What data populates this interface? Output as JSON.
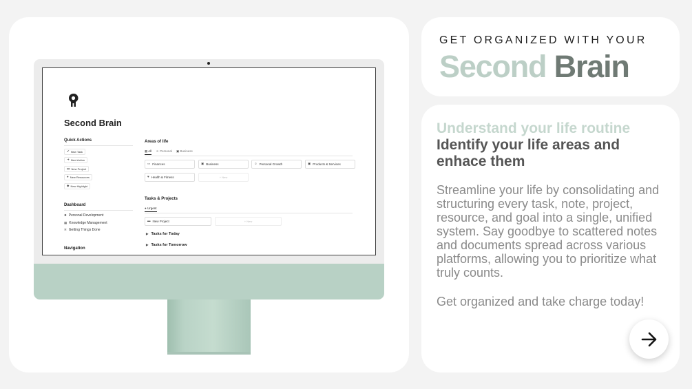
{
  "hero": {
    "eyebrow": "GET ORGANIZED WITH YOUR",
    "title_part1": "Second",
    "title_part2": "Brain"
  },
  "copy": {
    "subheading_light": "Understand your life routine",
    "subheading_dark": "Identify your life areas and enhace them",
    "paragraph": "Streamline your life by consolidating and structuring every task, note, project, resource, and goal into a single, unified system. Say goodbye to scattered notes and documents spread across various platforms, allowing you to prioritize what truly counts.",
    "cta": "Get organized and take charge today!"
  },
  "mockup": {
    "page_title": "Second Brain",
    "quick_actions": {
      "heading": "Quick Actions",
      "buttons": [
        "New Task",
        "Next Action",
        "New Project",
        "New Resources",
        "New Highlight"
      ]
    },
    "dashboard": {
      "heading": "Dashboard",
      "links": [
        "Personal Development",
        "Knowledge Management",
        "Getting Things Done"
      ]
    },
    "navigation": {
      "heading": "Navigation"
    },
    "areas": {
      "heading": "Areas of life",
      "tabs": [
        "All",
        "Personal",
        "Business"
      ],
      "cards": [
        "Finances",
        "Business",
        "Personal Growth",
        "Products & Services",
        "Health & Fitness"
      ],
      "new_label": "+ New"
    },
    "tasks": {
      "heading": "Tasks & Projects",
      "tab": "Urgent",
      "card": "New Project",
      "new_label": "+ New",
      "toggles": [
        "Tasks for Today",
        "Tasks for Tomorrow"
      ]
    }
  },
  "colors": {
    "accent_green": "#b8d1c5",
    "title_light": "#bccfc6",
    "title_dark": "#6f7a74"
  },
  "icons": {
    "next": "arrow-right-icon",
    "logo": "brain-head-icon"
  }
}
